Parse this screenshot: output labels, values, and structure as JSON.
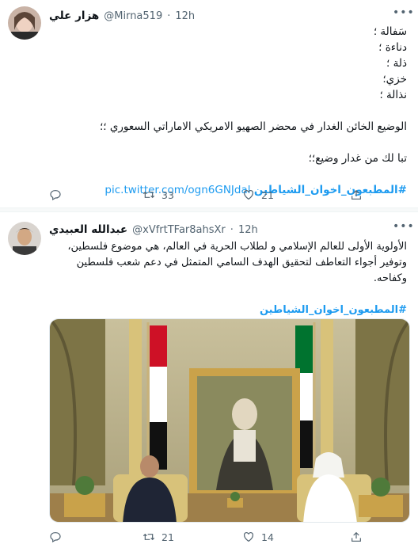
{
  "tweets": [
    {
      "name": "هزار علي",
      "handle": "@Mirna519",
      "time": "12h",
      "lines": [
        "سَفالة ؛",
        "دناءة ؛",
        "ذلة ؛",
        "خزي؛",
        "نذالة ؛",
        "",
        "الوضيع الخائن الغدار في محضر الصهيو الامريكي الاماراتي السعوري ؛؛",
        "",
        "تبا لك من غدار وضيع؛؛",
        ""
      ],
      "hashtag": "#المطبعون_اخوان_الشياطين",
      "link": "pic.twitter.com/ogn6GNJdal",
      "retweets": "33",
      "likes": "21"
    },
    {
      "name": "عبدالله العبيدي",
      "handle": "@xVfrtTFar8ahsXr",
      "time": "12h",
      "lines": [
        "الأولوية الأولى للعالم الإسلامي و لطلاب الحرية في العالم، هي موضوع فلسطين،",
        "وتوفير أجواء التعاطف لتحقيق الهدف السامي المتمثل في دعم شعب فلسطين",
        "وكفاحه.",
        ""
      ],
      "hashtag": "#المطبعون_اخوان_الشياطين",
      "retweets": "21",
      "likes": "14"
    }
  ],
  "icons": [
    "reply-icon",
    "retweet-icon",
    "like-icon",
    "share-icon",
    "more-icon"
  ],
  "colors": {
    "accent": "#1d9bf0",
    "muted": "#536471",
    "text": "#0f1419"
  }
}
